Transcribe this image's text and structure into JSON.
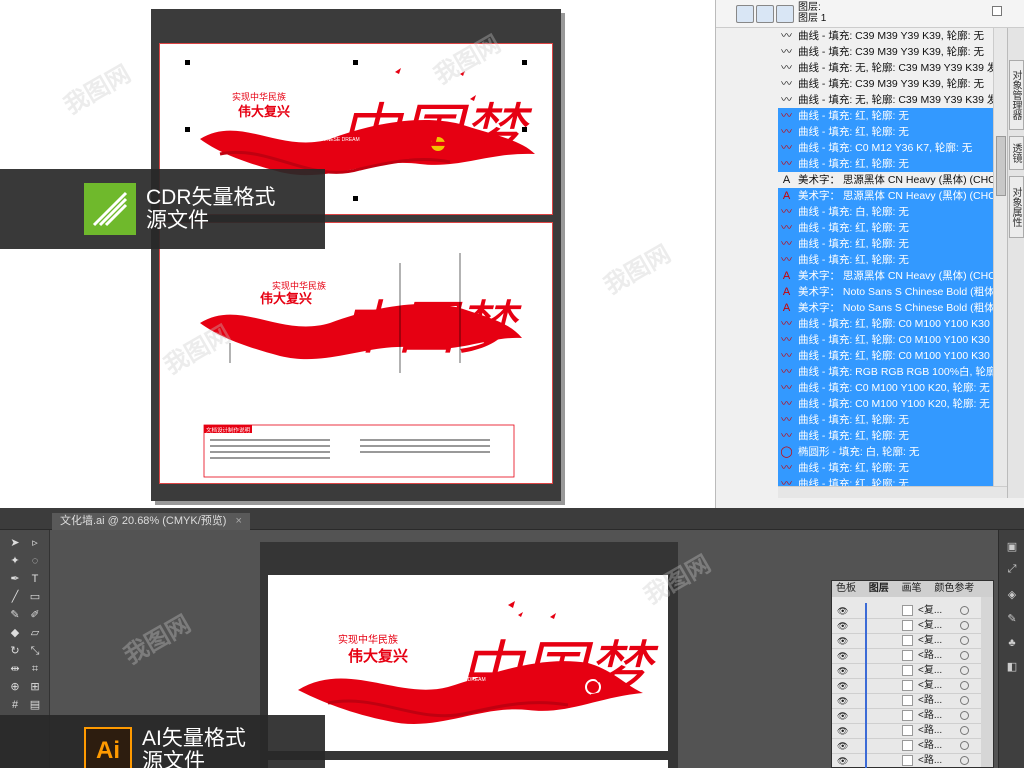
{
  "cdr": {
    "panel": {
      "header_line1": "图层:",
      "header_line2": "图层 1",
      "objects": [
        {
          "label": "曲线 - 填充: C39 M39 Y39 K39, 轮廓: 无",
          "selected": false,
          "icon": "curve"
        },
        {
          "label": "曲线 - 填充: C39 M39 Y39 K39, 轮廓: 无",
          "selected": false,
          "icon": "curve"
        },
        {
          "label": "曲线 - 填充: 无, 轮廓: C39 M39 Y39 K39 发丝",
          "selected": false,
          "icon": "curve"
        },
        {
          "label": "曲线 - 填充: C39 M39 Y39 K39, 轮廓: 无",
          "selected": false,
          "icon": "curve"
        },
        {
          "label": "曲线 - 填充: 无, 轮廓: C39 M39 Y39 K39 发丝",
          "selected": false,
          "icon": "curve"
        },
        {
          "label": "曲线 - 填充: 红, 轮廓: 无",
          "selected": true,
          "icon": "curve"
        },
        {
          "label": "曲线 - 填充: 红, 轮廓: 无",
          "selected": true,
          "icon": "curve"
        },
        {
          "label": "曲线 - 填充: C0 M12 Y36 K7, 轮廓: 无",
          "selected": true,
          "icon": "curve"
        },
        {
          "label": "曲线 - 填充: 红, 轮廓: 无",
          "selected": true,
          "icon": "curve"
        },
        {
          "label": "美术字： 思源黑体 CN Heavy (黑体) (CHC) - 填充: 红",
          "selected": false,
          "icon": "text"
        },
        {
          "label": "美术字： 思源黑体 CN Heavy (黑体) (CHC) - 填充",
          "selected": true,
          "icon": "text"
        },
        {
          "label": "曲线 - 填充: 白, 轮廓: 无",
          "selected": true,
          "icon": "curve"
        },
        {
          "label": "曲线 - 填充: 红, 轮廓: 无",
          "selected": true,
          "icon": "curve"
        },
        {
          "label": "曲线 - 填充: 红, 轮廓: 无",
          "selected": true,
          "icon": "curve"
        },
        {
          "label": "曲线 - 填充: 红, 轮廓: 无",
          "selected": true,
          "icon": "curve"
        },
        {
          "label": "美术字： 思源黑体 CN Heavy (黑体) (CHC) -",
          "selected": true,
          "icon": "text"
        },
        {
          "label": "美术字： Noto Sans S Chinese Bold (粗体)",
          "selected": true,
          "icon": "text"
        },
        {
          "label": "美术字： Noto Sans S Chinese Bold (粗体)",
          "selected": true,
          "icon": "text"
        },
        {
          "label": "曲线 - 填充: 红, 轮廓: C0 M100 Y100 K30 发",
          "selected": true,
          "icon": "curve"
        },
        {
          "label": "曲线 - 填充: 红, 轮廓: C0 M100 Y100 K30 发",
          "selected": true,
          "icon": "curve"
        },
        {
          "label": "曲线 - 填充: 红, 轮廓: C0 M100 Y100 K30 发",
          "selected": true,
          "icon": "curve"
        },
        {
          "label": "曲线 - 填充: RGB RGB RGB 100%白, 轮廓: 5",
          "selected": true,
          "icon": "curve"
        },
        {
          "label": "曲线 - 填充: C0 M100 Y100 K20, 轮廓: 无",
          "selected": true,
          "icon": "curve"
        },
        {
          "label": "曲线 - 填充: C0 M100 Y100 K20, 轮廓: 无",
          "selected": true,
          "icon": "curve"
        },
        {
          "label": "曲线 - 填充: 红, 轮廓: 无",
          "selected": true,
          "icon": "curve"
        },
        {
          "label": "曲线 - 填充: 红, 轮廓: 无",
          "selected": true,
          "icon": "curve"
        },
        {
          "label": "椭圆形 - 填充: 白, 轮廓: 无",
          "selected": true,
          "icon": "ellipse"
        },
        {
          "label": "曲线 - 填充: 红, 轮廓: 无",
          "selected": true,
          "icon": "curve"
        },
        {
          "label": "曲线 - 填充: 红, 轮廓: 无",
          "selected": true,
          "icon": "curve"
        }
      ],
      "side_tabs": [
        "对象管理器",
        "透镜",
        "对象属性"
      ]
    },
    "badge": {
      "line1": "CDR矢量格式",
      "line2": "源文件",
      "logo_color": "#6fb92c"
    },
    "artwork": {
      "headline_small": "实现中华民族",
      "headline_big": "伟大复兴",
      "calligraphy": "中国梦",
      "gongzhu": "共筑",
      "english": "CHINESE DREAM",
      "notes_title": "文档设计制作说明"
    }
  },
  "ai": {
    "doc_tab": "文化墙.ai @ 20.68% (CMYK/预览)",
    "badge": {
      "line1": "AI矢量格式",
      "line2": "源文件",
      "logo_text": "Ai",
      "logo_color": "#ff9a00"
    },
    "layers_panel": {
      "tabs": [
        "色板",
        "图层",
        "画笔",
        "颜色参考"
      ],
      "rows": [
        {
          "name": "<复..."
        },
        {
          "name": "<复..."
        },
        {
          "name": "<复..."
        },
        {
          "name": "<路..."
        },
        {
          "name": "<复..."
        },
        {
          "name": "<复..."
        },
        {
          "name": "<路..."
        },
        {
          "name": "<路..."
        },
        {
          "name": "<路..."
        },
        {
          "name": "<路..."
        },
        {
          "name": "<路..."
        }
      ]
    },
    "artwork": {
      "headline_small": "实现中华民族",
      "headline_big": "伟大复兴",
      "calligraphy": "中国梦",
      "gongzhu": "共筑",
      "english": "CHINESE DREAM"
    }
  },
  "colors": {
    "red": "#e60012",
    "selection": "#3399ff"
  }
}
